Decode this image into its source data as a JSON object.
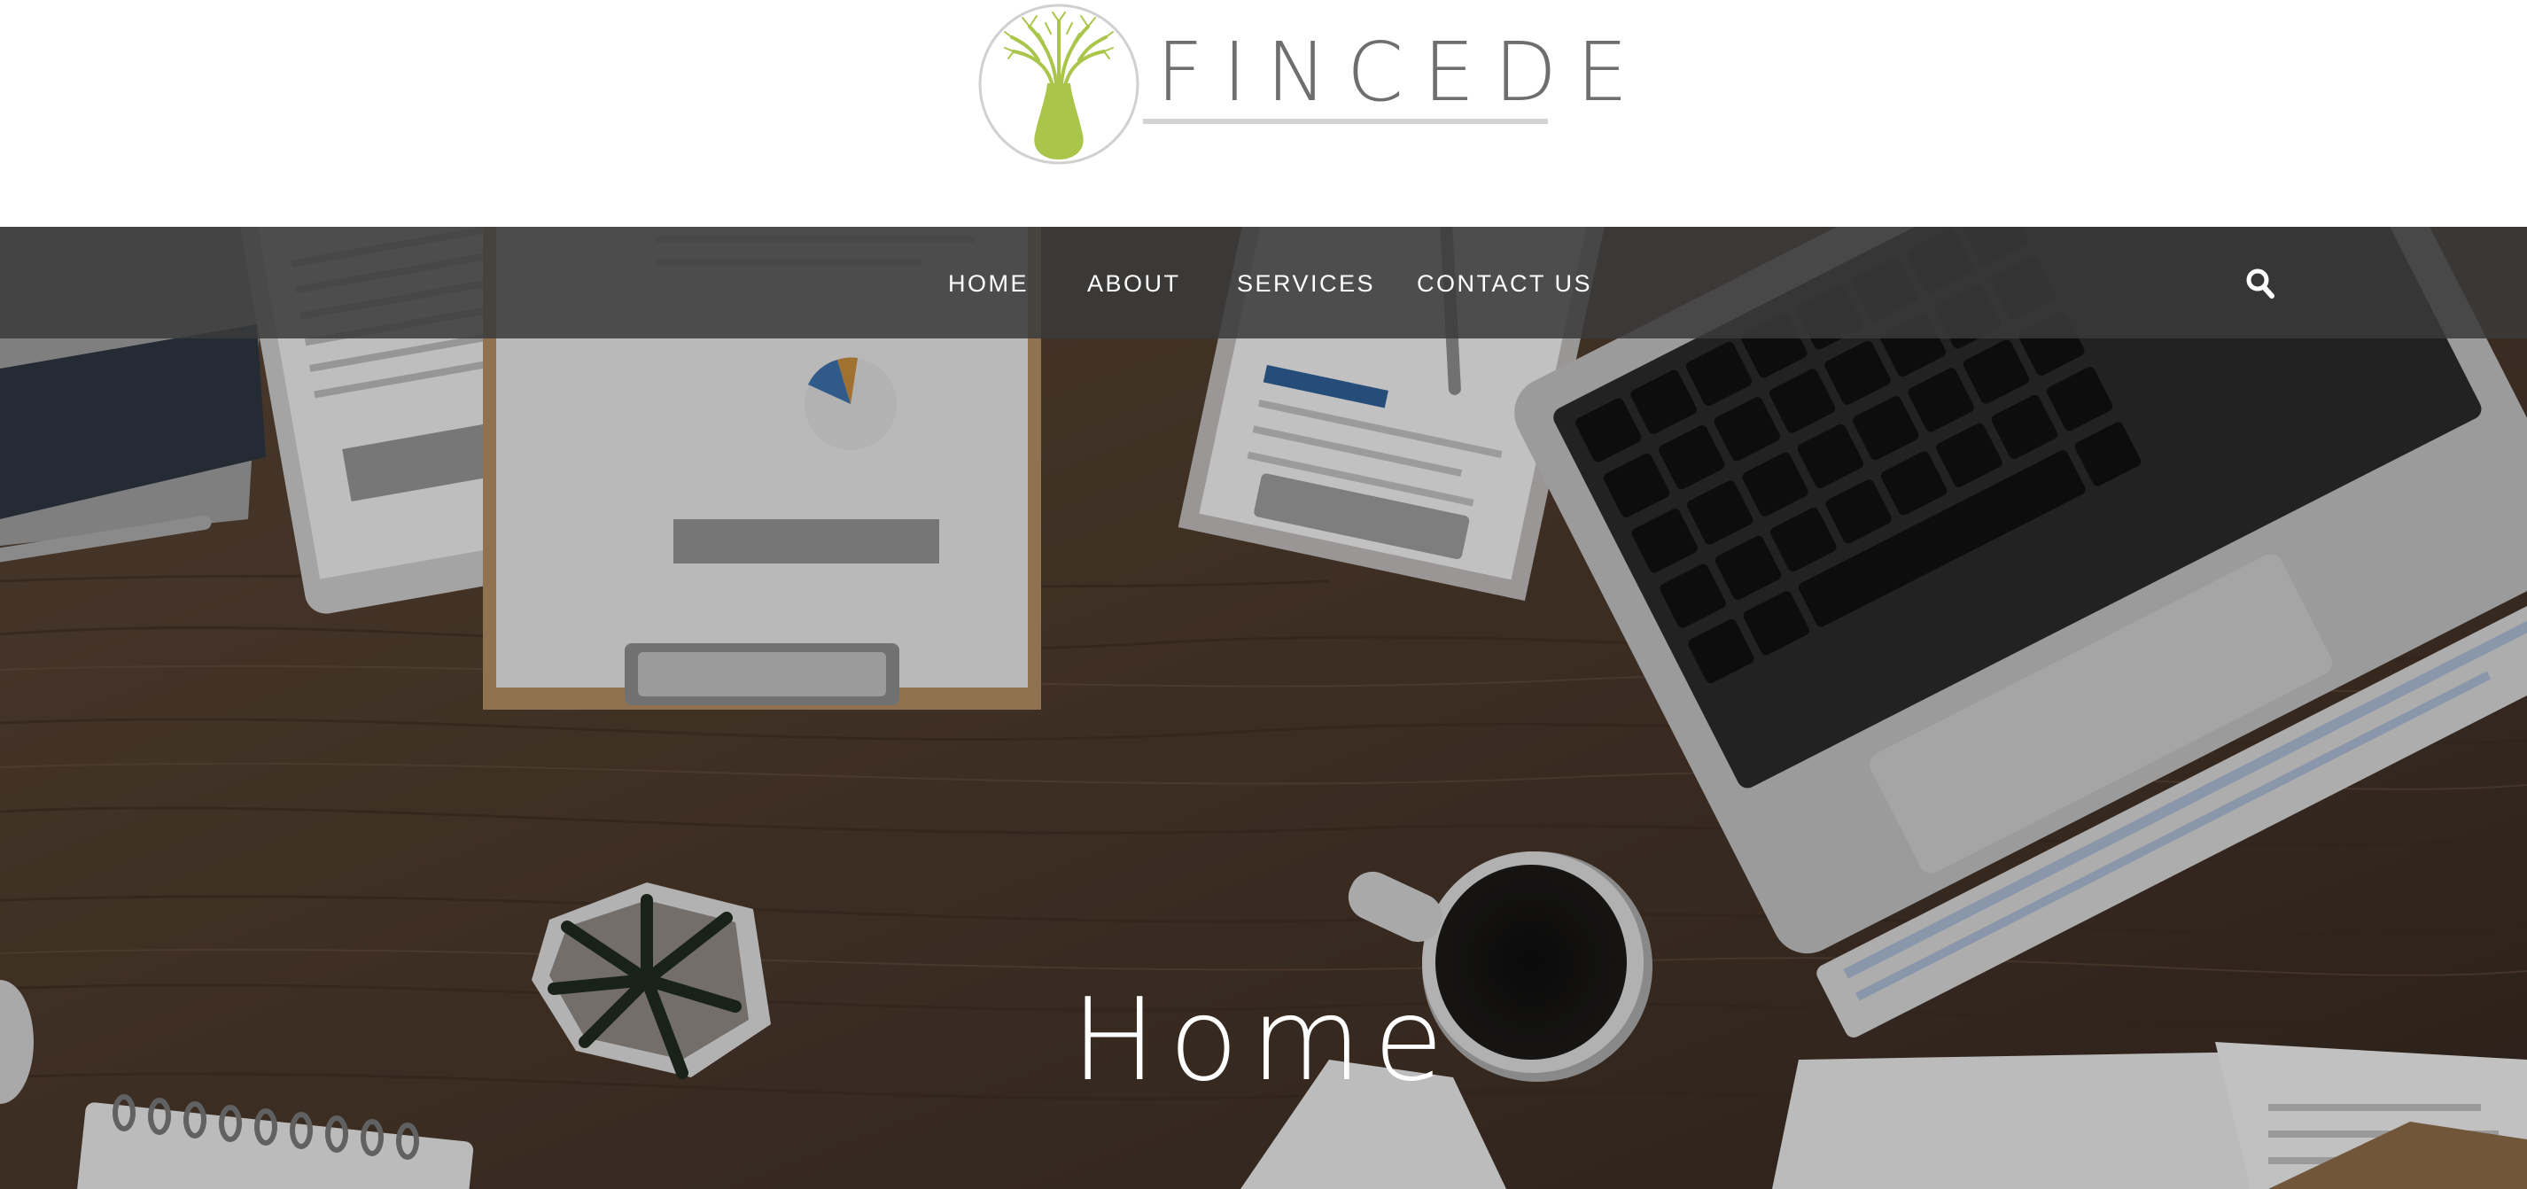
{
  "brand": {
    "name": "FINCEDE",
    "logo_icon": "baobab-tree-icon",
    "accent_green": "#a9c64a",
    "ring_gray": "#d0d0d0",
    "text_gray": "#6e6e6e"
  },
  "nav": {
    "items": [
      {
        "label": "HOME"
      },
      {
        "label": "ABOUT"
      },
      {
        "label": "SERVICES"
      },
      {
        "label": "CONTACT US"
      }
    ],
    "search_icon": "search-icon",
    "bar_color": "#3a3a3a"
  },
  "hero": {
    "title": "Home",
    "background": "desk-flatlay-photo"
  }
}
